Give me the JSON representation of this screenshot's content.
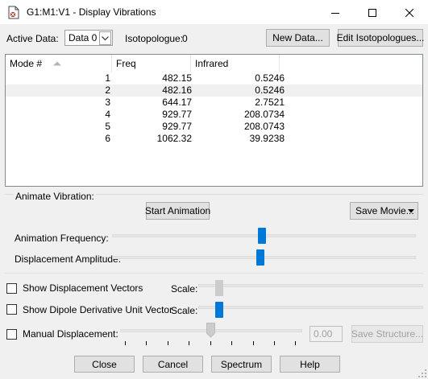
{
  "window": {
    "title": "G1:M1:V1 - Display Vibrations"
  },
  "toolbar": {
    "active_data_label": "Active Data:",
    "active_data_value": "Data 0",
    "isotopologue_label": "Isotopologue:",
    "isotopologue_value": "0",
    "new_data_label": "New Data...",
    "edit_isotopologues_label": "Edit Isotopologues..."
  },
  "table": {
    "columns": [
      "Mode #",
      "Freq",
      "Infrared"
    ],
    "rows": [
      {
        "mode": "1",
        "freq": "482.15",
        "ir": "0.5246"
      },
      {
        "mode": "2",
        "freq": "482.16",
        "ir": "0.5246"
      },
      {
        "mode": "3",
        "freq": "644.17",
        "ir": "2.7521"
      },
      {
        "mode": "4",
        "freq": "929.77",
        "ir": "208.0734"
      },
      {
        "mode": "5",
        "freq": "929.77",
        "ir": "208.0743"
      },
      {
        "mode": "6",
        "freq": "1062.32",
        "ir": "39.9238"
      }
    ],
    "selected_row": 2
  },
  "animate": {
    "section_label": "Animate Vibration:",
    "start_label": "Start Animation",
    "save_movie_label": "Save Movie...",
    "frequency_label": "Animation Frequency:",
    "frequency_level": 0.5,
    "amplitude_label": "Displacement Amplitude:",
    "amplitude_level": 0.49
  },
  "options": {
    "displacement_vectors_label": "Show Displacement Vectors",
    "displacement_vectors_checked": false,
    "dipole_label": "Show Dipole Derivative Unit Vector",
    "dipole_checked": false,
    "scale_label": "Scale:",
    "manual_label": "Manual Displacement:",
    "manual_checked": false,
    "manual_value": "0.00",
    "save_structure_label": "Save Structure..."
  },
  "footer": {
    "close_label": "Close",
    "cancel_label": "Cancel",
    "spectrum_label": "Spectrum",
    "help_label": "Help"
  },
  "colors": {
    "accent": "#0078d7",
    "selected_row": "#f0f0f0",
    "dialog_bg": "#f0f0f0"
  }
}
